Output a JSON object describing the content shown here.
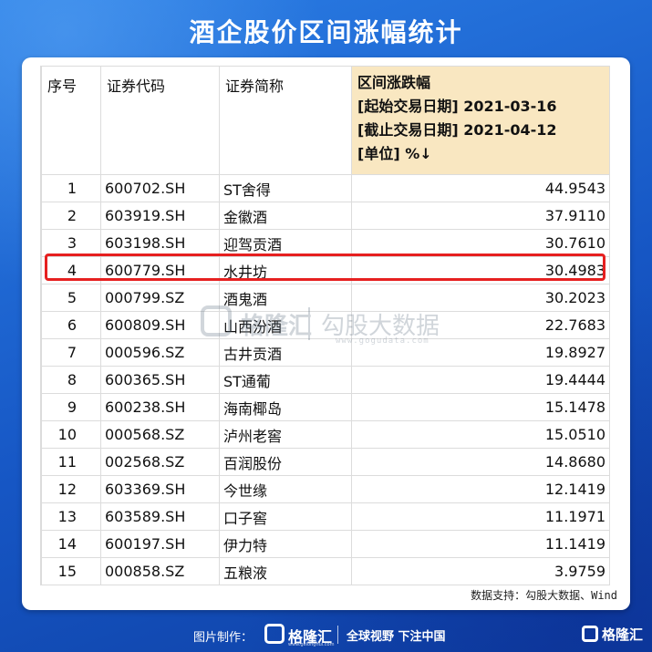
{
  "page": {
    "title": "酒企股价区间涨幅统计"
  },
  "table": {
    "headers": {
      "index": "序号",
      "code": "证券代码",
      "name": "证券简称",
      "range_title": "区间涨跌幅",
      "range_start": "[起始交易日期] 2021-03-16",
      "range_end": "[截止交易日期] 2021-04-12",
      "range_unit": "[单位] %↓"
    },
    "rows": [
      {
        "index": "1",
        "code": "600702.SH",
        "name": "ST舍得",
        "value": "44.9543"
      },
      {
        "index": "2",
        "code": "603919.SH",
        "name": "金徽酒",
        "value": "37.9110"
      },
      {
        "index": "3",
        "code": "603198.SH",
        "name": "迎驾贡酒",
        "value": "30.7610"
      },
      {
        "index": "4",
        "code": "600779.SH",
        "name": "水井坊",
        "value": "30.4983"
      },
      {
        "index": "5",
        "code": "000799.SZ",
        "name": "酒鬼酒",
        "value": "30.2023"
      },
      {
        "index": "6",
        "code": "600809.SH",
        "name": "山西汾酒",
        "value": "22.7683"
      },
      {
        "index": "7",
        "code": "000596.SZ",
        "name": "古井贡酒",
        "value": "19.8927"
      },
      {
        "index": "8",
        "code": "600365.SH",
        "name": "ST通葡",
        "value": "19.4444"
      },
      {
        "index": "9",
        "code": "600238.SH",
        "name": "海南椰岛",
        "value": "15.1478"
      },
      {
        "index": "10",
        "code": "000568.SZ",
        "name": "泸州老窖",
        "value": "15.0510"
      },
      {
        "index": "11",
        "code": "002568.SZ",
        "name": "百润股份",
        "value": "14.8680"
      },
      {
        "index": "12",
        "code": "603369.SH",
        "name": "今世缘",
        "value": "12.1419"
      },
      {
        "index": "13",
        "code": "603589.SH",
        "name": "口子窖",
        "value": "11.1971"
      },
      {
        "index": "14",
        "code": "600197.SH",
        "name": "伊力特",
        "value": "11.1419"
      },
      {
        "index": "15",
        "code": "000858.SZ",
        "name": "五粮液",
        "value": "3.9759"
      }
    ],
    "highlighted_row_index": "4"
  },
  "watermark": {
    "brand": "格隆汇",
    "name": "勾股大数据",
    "url": "www.gogudata.com"
  },
  "source": "数据支持：勾股大数据、Wind",
  "footer": {
    "label": "图片制作：",
    "brand": "格隆汇",
    "brand_sub": "www.gelonghui.com",
    "slogan": "全球视野 下注中国",
    "corner_brand": "格隆汇"
  },
  "colors": {
    "highlight_border": "#e62020",
    "header_accent": "#f9e7c1",
    "background": "#1d64d6"
  }
}
